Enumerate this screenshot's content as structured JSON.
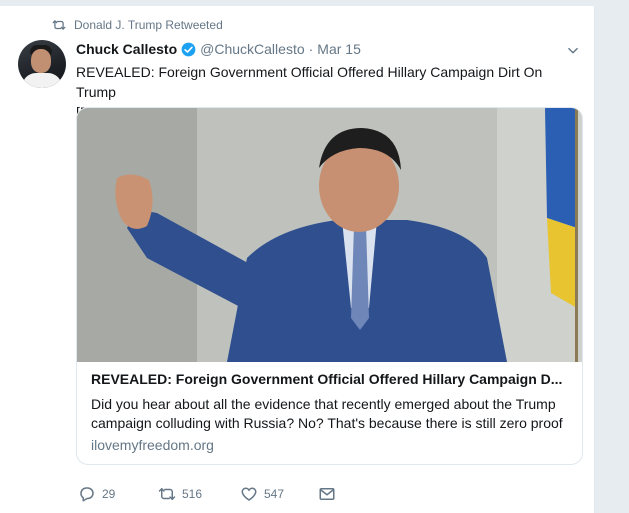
{
  "retweet_context": {
    "text": "Donald J. Trump Retweeted",
    "icon": "retweet-icon"
  },
  "author": {
    "name": "Chuck Callesto",
    "handle": "@ChuckCallesto",
    "separator": "·",
    "date": "Mar 15",
    "verified": true
  },
  "tweet": {
    "text_line1": "REVEALED: Foreign Government Official Offered Hillary Campaign Dirt On Trump",
    "text_line2": "[Details]"
  },
  "link_card": {
    "title": "REVEALED: Foreign Government Official Offered Hillary Campaign D...",
    "description": "Did you hear about all the evidence that recently emerged about the Trump campaign colluding with Russia? No? That's because there is still zero proof",
    "domain": "ilovemyfreedom.org"
  },
  "actions": {
    "replies": "29",
    "retweets": "516",
    "likes": "547"
  },
  "colors": {
    "accent": "#1da1f2",
    "muted": "#657786",
    "text": "#14171a",
    "border": "#e1e8ed",
    "background": "#e6ecf0"
  }
}
